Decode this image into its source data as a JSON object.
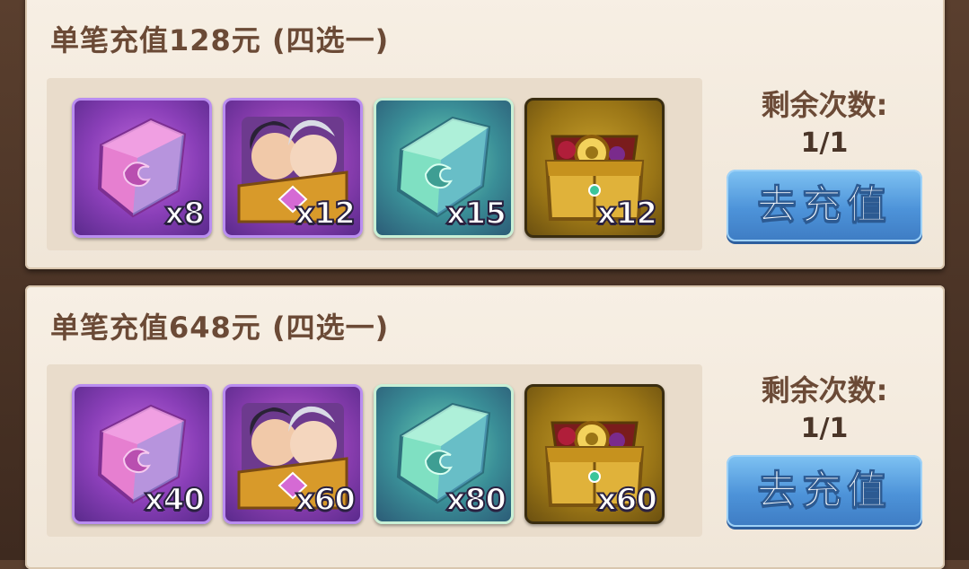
{
  "offers": [
    {
      "title": "单笔充值128元 (四选一)",
      "remaining_label": "剩余次数:",
      "remaining_value": "1/1",
      "button_label": "去充值",
      "items": [
        {
          "icon": "purple-crystal-icon",
          "quantity": "x8"
        },
        {
          "icon": "hero-chest-icon",
          "quantity": "x12"
        },
        {
          "icon": "green-crystal-icon",
          "quantity": "x15"
        },
        {
          "icon": "gold-treasure-chest-icon",
          "quantity": "x12"
        }
      ]
    },
    {
      "title": "单笔充值648元 (四选一)",
      "remaining_label": "剩余次数:",
      "remaining_value": "1/1",
      "button_label": "去充值",
      "items": [
        {
          "icon": "purple-crystal-icon",
          "quantity": "x40"
        },
        {
          "icon": "hero-chest-icon",
          "quantity": "x60"
        },
        {
          "icon": "green-crystal-icon",
          "quantity": "x80"
        },
        {
          "icon": "gold-treasure-chest-icon",
          "quantity": "x60"
        }
      ]
    }
  ],
  "colors": {
    "card_bg": "#f3eadf",
    "title_text": "#6b4a36",
    "button_blue": "#4d93d9"
  }
}
